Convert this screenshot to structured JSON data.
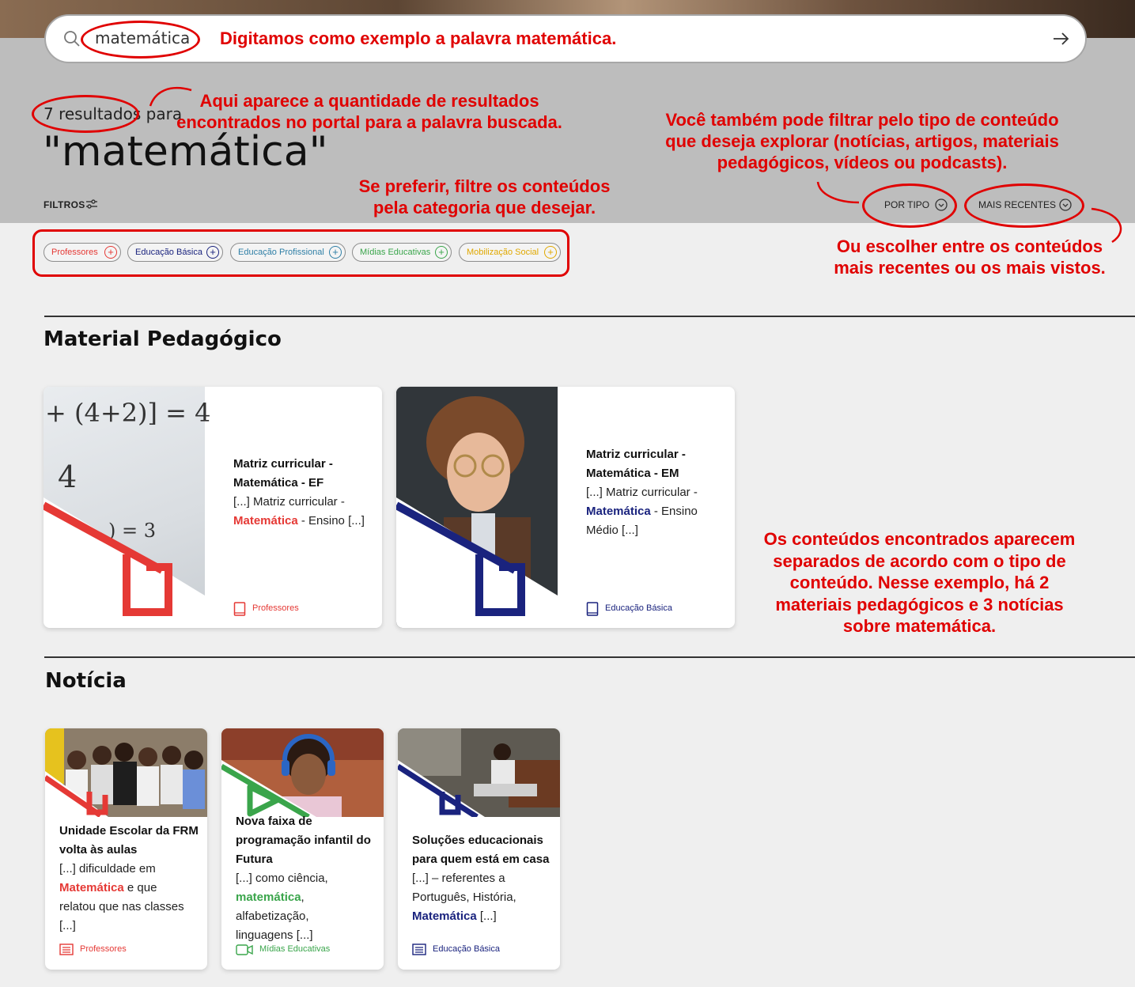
{
  "search": {
    "value": "matemática"
  },
  "results": {
    "count_label": "7 resultados",
    "for_label": "para",
    "query_title": "\"matemática\""
  },
  "filters": {
    "label": "FILTROS",
    "categories": [
      {
        "label": "Professores",
        "color": "#e53935"
      },
      {
        "label": "Educação Básica",
        "color": "#1a237e"
      },
      {
        "label": "Educação Profissional",
        "color": "#2f7fa6"
      },
      {
        "label": "Mídias Educativas",
        "color": "#3aa54b"
      },
      {
        "label": "Mobilização Social",
        "color": "#e0a800"
      }
    ]
  },
  "sort": {
    "by_type": "POR TIPO",
    "recent": "MAIS RECENTES"
  },
  "annotations": {
    "search_note": "Digitamos como exemplo a palavra matemática.",
    "count_note_1": "Aqui aparece a quantidade de resultados",
    "count_note_2": "encontrados no portal para a palavra buscada.",
    "type_note_1": "Você também pode filtrar pelo tipo de conteúdo",
    "type_note_2": "que deseja explorar (notícias, artigos, materiais",
    "type_note_3": "pedagógicos, vídeos ou podcasts).",
    "category_note_1": "Se preferir, filtre os conteúdos",
    "category_note_2": "pela categoria que desejar.",
    "recent_note_1": "Ou escolher entre os conteúdos",
    "recent_note_2": "mais recentes ou os mais vistos.",
    "sections_note_1": "Os conteúdos encontrados aparecem",
    "sections_note_2": "separados de acordo com o tipo de",
    "sections_note_3": "conteúdo. Nesse exemplo, há 2",
    "sections_note_4": "materiais pedagógicos e 3 notícias",
    "sections_note_5": "sobre matemática."
  },
  "material_section": {
    "title": "Material Pedagógico",
    "cards": [
      {
        "title_1": "Matriz curricular -",
        "title_2": "Matemática - EF",
        "snippet_pre": "[...] Matriz curricular -",
        "highlight": "Matemática",
        "snippet_post": " - Ensino [...]",
        "tag": "Professores",
        "color": "#e53935",
        "image_text_1": "+ (4+2)]  = 4",
        "image_text_2": "4",
        "image_text_3": ")  =   3"
      },
      {
        "title_1": "Matriz curricular -",
        "title_2": "Matemática - EM",
        "snippet_pre": "[...] Matriz curricular -",
        "highlight": "Matemática",
        "snippet_post": " - Ensino",
        "snippet_post_2": "Médio [...]",
        "tag": "Educação Básica",
        "color": "#1a237e"
      }
    ]
  },
  "news_section": {
    "title": "Notícia",
    "cards": [
      {
        "title_1": "Unidade Escolar da FRM",
        "title_2": "volta às aulas",
        "line_1": "[...] dificuldade em",
        "highlight": "Matemática",
        "line_2_post": " e que",
        "line_3": "relatou que nas classes",
        "line_4": "[...]",
        "tag": "Professores",
        "color": "#e53935"
      },
      {
        "title_1": "Nova faixa de",
        "title_2": "programação infantil do",
        "title_3": "Futura",
        "line_1": "[...] como ciência,",
        "highlight": "matemática",
        "line_2_post": ",",
        "line_3": "alfabetização,",
        "line_4": "linguagens [...]",
        "tag": "Mídias Educativas",
        "color": "#3aa54b"
      },
      {
        "title_1": "Soluções educacionais",
        "title_2": "para quem está em casa",
        "line_1": "[...] – referentes a",
        "line_2": "Português, História,",
        "highlight": "Matemática",
        "line_3_post": " [...]",
        "tag": "Educação Básica",
        "color": "#1a237e"
      }
    ]
  }
}
